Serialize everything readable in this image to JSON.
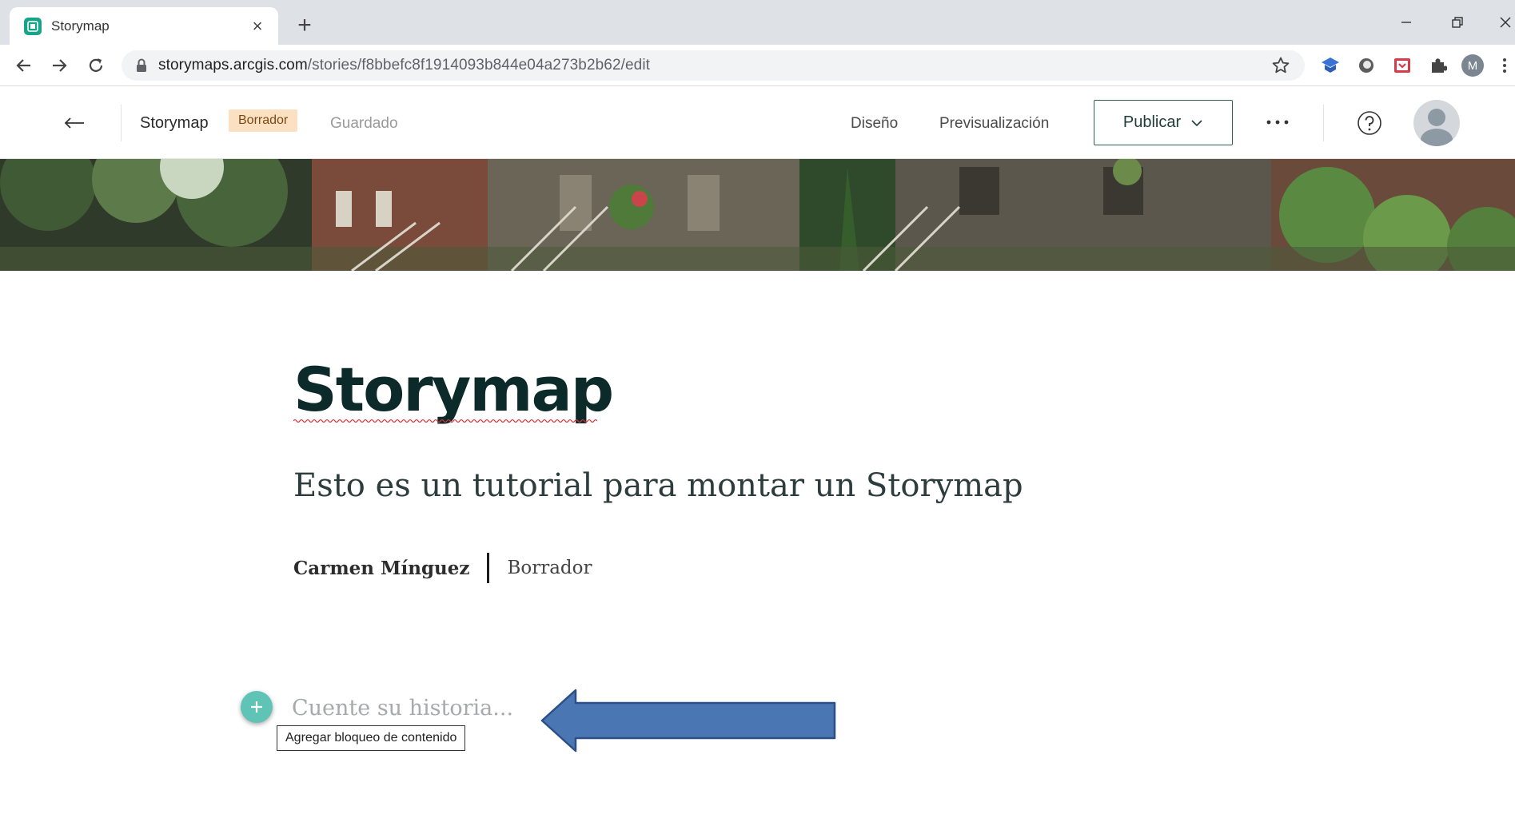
{
  "browser": {
    "tab_title": "Storymap",
    "tab_close": "×",
    "new_tab": "+",
    "url_host": "storymaps.arcgis.com",
    "url_path": "/stories/f8bbefc8f1914093b844e04a273b2b62/edit",
    "profile_initial": "M",
    "icons": [
      "back-icon",
      "forward-icon",
      "reload-icon",
      "lock-icon",
      "star-icon",
      "extension-icon",
      "puzzle-icon"
    ]
  },
  "header": {
    "title": "Storymap",
    "badge": "Borrador",
    "saved": "Guardado",
    "design": "Diseño",
    "preview": "Previsualización",
    "publish": "Publicar",
    "more": "···"
  },
  "story": {
    "title": "Storymap",
    "subtitle": "Esto es un tutorial para montar un Storymap",
    "author": "Carmen Mínguez",
    "status": "Borrador",
    "placeholder": "Cuente su historia...",
    "tooltip": "Agregar bloqueo de contenido"
  },
  "colors": {
    "accent": "#5fc4b5",
    "badge_bg": "#fbe1c2",
    "publish_border": "#2f5f59",
    "annotation_arrow": "#4a77b4"
  }
}
